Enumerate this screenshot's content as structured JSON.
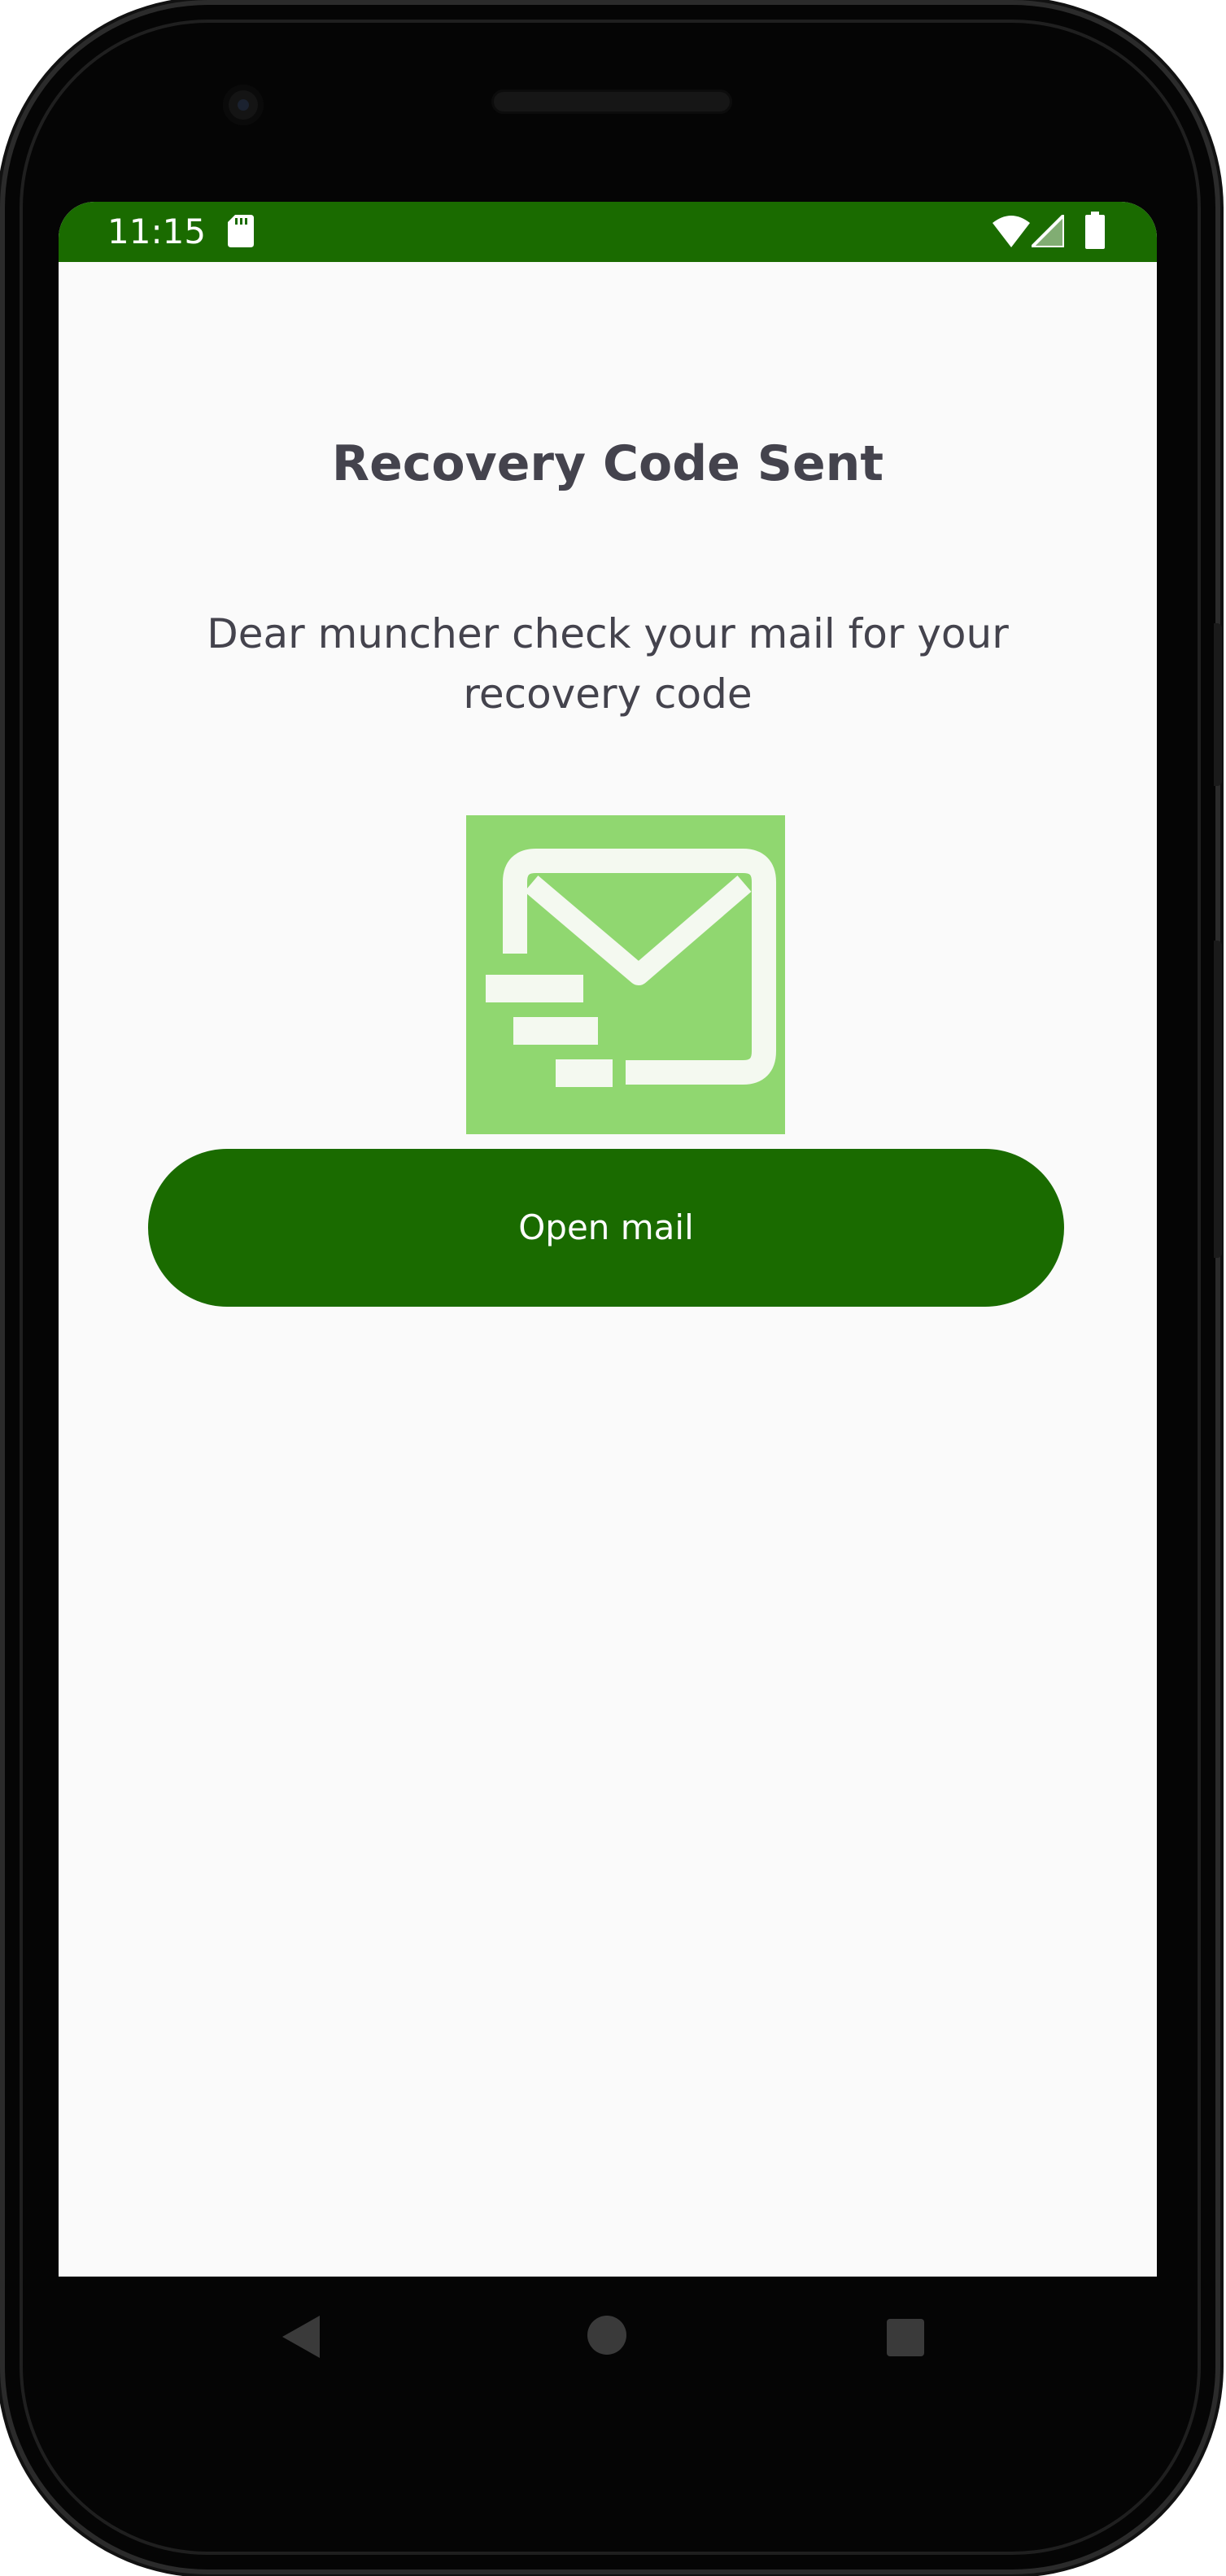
{
  "status_bar": {
    "time": "11:15",
    "icons": [
      "sd-card-icon",
      "wifi-icon",
      "cellular-signal-icon",
      "battery-icon"
    ]
  },
  "main": {
    "title": "Recovery Code Sent",
    "message": "Dear muncher check your mail for your recovery code",
    "illustration": "mail-sent-icon",
    "button_label": "Open mail"
  },
  "nav_bar": {
    "icons": [
      "back-icon",
      "home-icon",
      "recents-icon"
    ]
  },
  "colors": {
    "primary": "#1a6b00",
    "illustration_bg": "#90d770",
    "illustration_fg": "#f4f9f0",
    "text": "#44434d",
    "background": "#fafafa"
  }
}
